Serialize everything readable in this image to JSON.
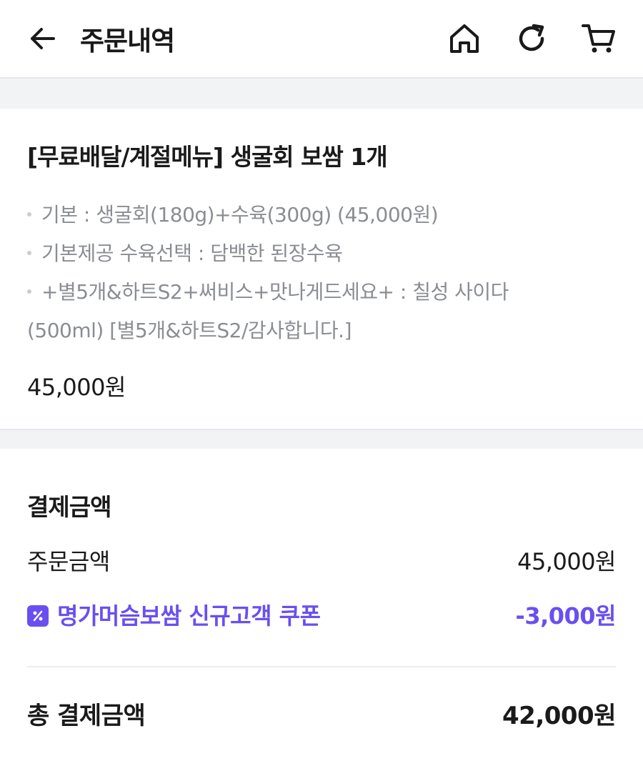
{
  "header": {
    "title": "주문내역"
  },
  "order": {
    "title": "[무료배달/계절메뉴] 생굴회 보쌈 1개",
    "options": [
      "기본 : 생굴회(180g)+수육(300g) (45,000원)",
      "기본제공 수육선택 : 담백한 된장수육",
      "+별5개&하트S2+써비스+맛나게드세요+ : 칠성 사이다",
      "(500ml) [별5개&하트S2/감사합니다.]"
    ],
    "price": "45,000원"
  },
  "payment": {
    "title": "결제금액",
    "order_amount_label": "주문금액",
    "order_amount_value": "45,000원",
    "coupon_label": "명가머슴보쌈 신규고객 쿠폰",
    "coupon_value": "-3,000원",
    "total_label": "총 결제금액",
    "total_value": "42,000원"
  },
  "colors": {
    "accent": "#6a4ff0",
    "muted": "#8a8d92"
  },
  "icons": [
    "arrow-left-icon",
    "home-icon",
    "refresh-icon",
    "cart-icon",
    "coupon-icon"
  ]
}
